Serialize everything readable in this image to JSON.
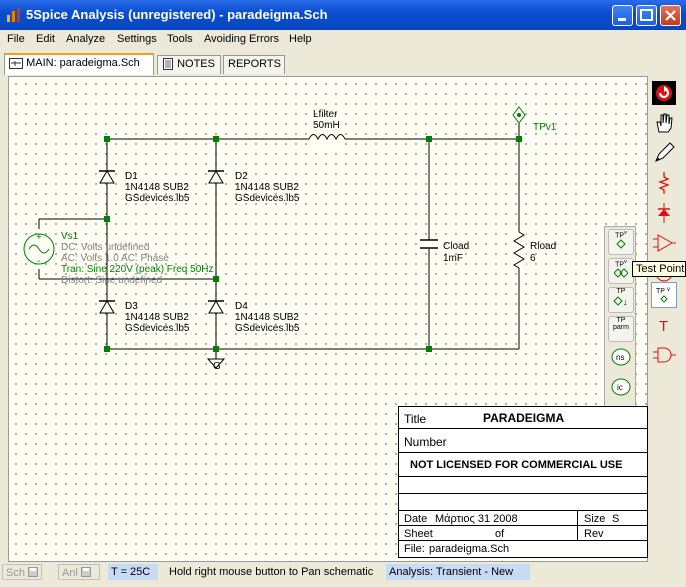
{
  "window": {
    "title": "5Spice Analysis (unregistered) - paradeigma.Sch"
  },
  "menu": [
    "File",
    "Edit",
    "Analyze",
    "Settings",
    "Tools",
    "Avoiding Errors",
    "Help"
  ],
  "tabs": [
    {
      "label": "MAIN:  paradeigma.Sch"
    },
    {
      "label": "NOTES"
    },
    {
      "label": "REPORTS"
    }
  ],
  "schematic": {
    "vs1": {
      "name": "Vs1",
      "dc": "DC: Volts undefined",
      "ac": "AC: Volts  1.0  AC: Phase",
      "tran": "Tran: Sine  220V (peak)  Freq 50Hz",
      "distort": "Distort: Sine  undefined"
    },
    "diodes": [
      {
        "name": "D1",
        "model": "1N4148  SUB2",
        "lib": "GSdevices.lb5"
      },
      {
        "name": "D2",
        "model": "1N4148  SUB2",
        "lib": "GSdevices.lb5"
      },
      {
        "name": "D3",
        "model": "1N4148  SUB2",
        "lib": "GSdevices.lb5"
      },
      {
        "name": "D4",
        "model": "1N4148  SUB2",
        "lib": "GSdevices.lb5"
      }
    ],
    "lfilter": {
      "name": "Lfilter",
      "value": "50mH"
    },
    "cload": {
      "name": "Cload",
      "value": "1mF"
    },
    "rload": {
      "name": "Rload",
      "value": "6"
    },
    "testpoint": {
      "name": "TPv1"
    },
    "ground_label": "G"
  },
  "tp_panel": {
    "buttons": [
      {
        "top": "TP",
        "sub": "v"
      },
      {
        "top": "TP",
        "sub": "v"
      },
      {
        "top": "TP",
        "sub": "↓"
      },
      {
        "top": "TP",
        "sub": "parm"
      },
      {
        "top": "",
        "sub": "ns"
      },
      {
        "top": "",
        "sub": "ic"
      }
    ]
  },
  "tooltip": "Test Point,",
  "right_tools": {
    "tp_label": "TP",
    "tp_sub": "v",
    "text_tool": "T"
  },
  "title_block": {
    "title_label": "Title",
    "title_value": "PARADEIGMA",
    "number_label": "Number",
    "license": "NOT LICENSED FOR COMMERCIAL USE",
    "date_label": "Date",
    "date_value": "Μάρτιος 31 2008",
    "size_label": "Size",
    "size_value": "S",
    "sheet_label": "Sheet",
    "of_label": "of",
    "rev_label": "Rev",
    "file_label": "File:",
    "file_value": "paradeigma.Sch"
  },
  "statusbar": {
    "sch": "Sch",
    "anl": "Anl",
    "temp": "T = 25C",
    "hint": "Hold right mouse button to Pan schematic",
    "analysis": "Analysis:  Transient - New"
  },
  "colors": {
    "wire": "#000000",
    "node": "#008000",
    "tp": "#008000",
    "label_green": "#008000",
    "label_gray": "#808080",
    "status_highlight": "#c7dbf7"
  }
}
